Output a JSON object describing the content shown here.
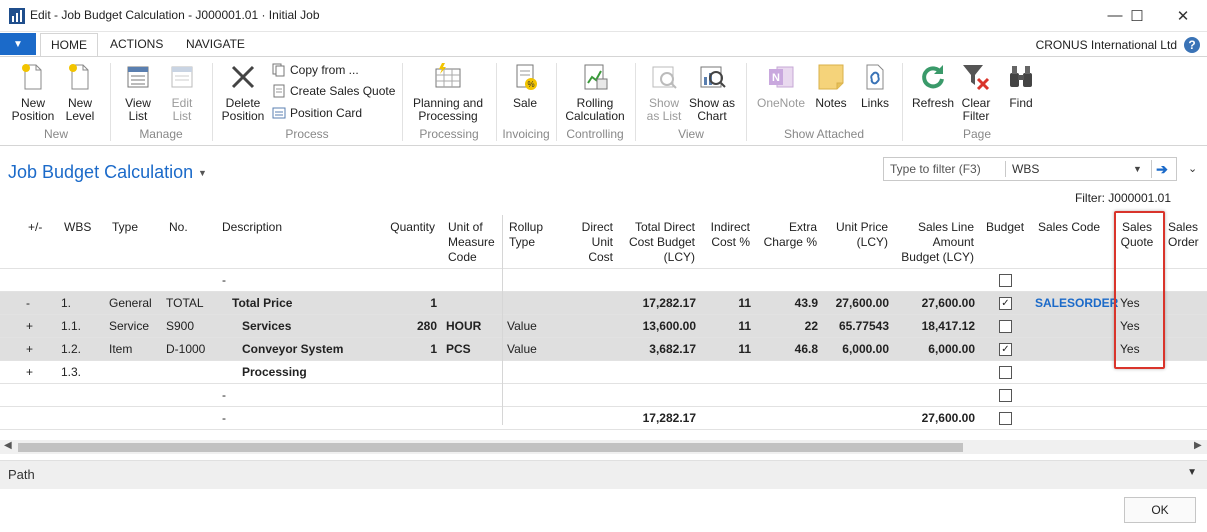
{
  "window": {
    "title": "Edit - Job Budget Calculation - J000001.01 · Initial Job",
    "minimize": "—",
    "maximize": "☐",
    "close": "✕"
  },
  "tabs": [
    {
      "label": "HOME"
    },
    {
      "label": "ACTIONS"
    },
    {
      "label": "NAVIGATE"
    }
  ],
  "company": "CRONUS International Ltd",
  "help": "?",
  "ribbon": {
    "new_position": "New Position",
    "new_level": "New Level",
    "view_list": "View List",
    "edit_list": "Edit List",
    "delete_position": "Delete Position",
    "copy_from": "Copy from ...",
    "create_sales_quote": "Create Sales Quote",
    "position_card": "Position Card",
    "planning_processing": "Planning and Processing",
    "sale": "Sale",
    "rolling_calculation": "Rolling Calculation",
    "show_as_list": "Show as List",
    "show_as_chart": "Show as Chart",
    "onenote": "OneNote",
    "notes": "Notes",
    "links": "Links",
    "refresh": "Refresh",
    "clear_filter": "Clear Filter",
    "find": "Find",
    "groups": {
      "new": "New",
      "manage": "Manage",
      "process": "Process",
      "processing": "Processing",
      "invoicing": "Invoicing",
      "controlling": "Controlling",
      "view": "View",
      "show_attached": "Show Attached",
      "page": "Page"
    }
  },
  "page": {
    "title": "Job Budget Calculation",
    "filter_placeholder": "Type to filter (F3)",
    "filter_field": "WBS",
    "filter_text": "Filter: J000001.01"
  },
  "columns": {
    "plusminus": "+/-",
    "wbs": "WBS",
    "type": "Type",
    "no": "No.",
    "description": "Description",
    "quantity": "Quantity",
    "uom_1": "Unit of",
    "uom_2": "Measure",
    "uom_3": "Code",
    "rollup_1": "Rollup",
    "rollup_2": "Type",
    "duc_1": "Direct",
    "duc_2": "Unit",
    "duc_3": "Cost",
    "tdcb_1": "Total Direct",
    "tdcb_2": "Cost Budget",
    "tdcb_3": "(LCY)",
    "ind_1": "Indirect",
    "ind_2": "Cost %",
    "ext_1": "Extra",
    "ext_2": "Charge %",
    "up_1": "Unit Price",
    "up_2": "(LCY)",
    "sla_1": "Sales Line",
    "sla_2": "Amount",
    "sla_3": "Budget (LCY)",
    "budget": "Budget",
    "sales_code": "Sales Code",
    "sq_1": "Sales",
    "sq_2": "Quote",
    "so_1": "Sales",
    "so_2": "Order"
  },
  "rows": [
    {
      "pm": "",
      "wbs": "",
      "type": "",
      "no": "",
      "desc": "-",
      "qty": "",
      "uom": "",
      "rollup": "",
      "tdcb": "",
      "ind": "",
      "ext": "",
      "up": "",
      "sla": "",
      "budget": false,
      "sales_code": "",
      "sq": ""
    },
    {
      "pm": "-",
      "wbs": "1.",
      "type": "General",
      "no": "TOTAL",
      "desc": "Total Price",
      "qty": "1",
      "uom": "",
      "rollup": "",
      "tdcb": "17,282.17",
      "ind": "11",
      "ext": "43.9",
      "up": "27,600.00",
      "sla": "27,600.00",
      "budget": true,
      "sales_code": "SALESORDER",
      "sq": "Yes"
    },
    {
      "pm": "+",
      "wbs": "1.1.",
      "type": "Service",
      "no": "S900",
      "desc": "Services",
      "qty": "280",
      "uom": "HOUR",
      "rollup": "Value",
      "tdcb": "13,600.00",
      "ind": "11",
      "ext": "22",
      "up": "65.77543",
      "sla": "18,417.12",
      "budget": false,
      "sales_code": "",
      "sq": "Yes"
    },
    {
      "pm": "+",
      "wbs": "1.2.",
      "type": "Item",
      "no": "D-1000",
      "desc": "Conveyor System",
      "qty": "1",
      "uom": "PCS",
      "rollup": "Value",
      "tdcb": "3,682.17",
      "ind": "11",
      "ext": "46.8",
      "up": "6,000.00",
      "sla": "6,000.00",
      "budget": true,
      "sales_code": "",
      "sq": "Yes"
    },
    {
      "pm": "+",
      "wbs": "1.3.",
      "type": "",
      "no": "",
      "desc": "Processing",
      "qty": "",
      "uom": "",
      "rollup": "",
      "tdcb": "",
      "ind": "",
      "ext": "",
      "up": "",
      "sla": "",
      "budget": false,
      "sales_code": "",
      "sq": ""
    },
    {
      "pm": "",
      "wbs": "",
      "type": "",
      "no": "",
      "desc": "-",
      "qty": "",
      "uom": "",
      "rollup": "",
      "tdcb": "",
      "ind": "",
      "ext": "",
      "up": "",
      "sla": "",
      "budget": false,
      "sales_code": "",
      "sq": ""
    },
    {
      "pm": "",
      "wbs": "",
      "type": "",
      "no": "",
      "desc": "-",
      "qty": "",
      "uom": "",
      "rollup": "",
      "tdcb": "17,282.17",
      "ind": "",
      "ext": "",
      "up": "",
      "sla": "27,600.00",
      "budget": false,
      "sales_code": "",
      "sq": ""
    }
  ],
  "path_label": "Path",
  "ok_label": "OK",
  "colors": {
    "accent": "#1b6ac9",
    "highlight": "#d9342b",
    "selected_row": "#dfdfdf"
  }
}
